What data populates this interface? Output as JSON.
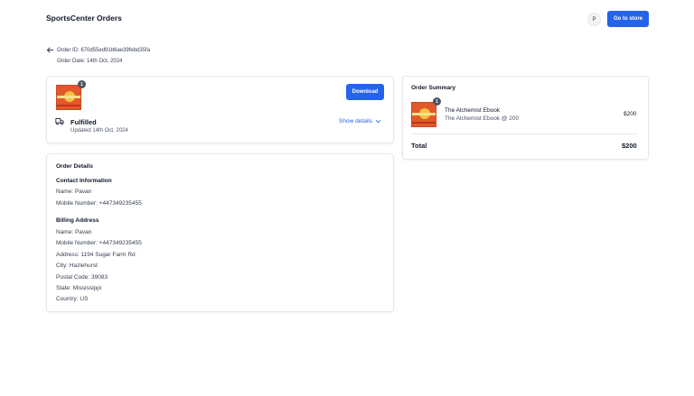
{
  "nav": {
    "brand": "SportsCenter",
    "orders_link": "Orders",
    "avatar_initial": "P",
    "store_button": "Go to store"
  },
  "order": {
    "id_text": "Order ID: 670d55ed91b6ae39febd35fa",
    "date_text": "Order Date: 14th Oct, 2024"
  },
  "status_card": {
    "item_count": "1",
    "download_label": "Download",
    "status": "Fulfilled",
    "updated": "Updated 14th Oct, 2024",
    "show_details": "Show details"
  },
  "details": {
    "title": "Order Details",
    "contact_title": "Contact Information",
    "contact_name": "Name: Pavan",
    "contact_mobile": "Mobile Number: +447349235455",
    "billing_title": "Billing Address",
    "billing_name": "Name: Pavan",
    "billing_mobile": "Mobile Number: +447349235455",
    "billing_address": "Address: 1194 Sugar Farm Rd",
    "billing_city": "City: Hazlehurst",
    "billing_postal": "Postal Code: 39083",
    "billing_state": "State: Mississippi",
    "billing_country": "Country: US"
  },
  "summary": {
    "title": "Order Summary",
    "item_count": "1",
    "item_name": "The Alchemist Ebook",
    "item_subtitle": "The Alchemist Ebook @ 200",
    "item_price": "$200",
    "total_label": "Total",
    "total_value": "$200"
  },
  "icons": {
    "back": "arrow-left-icon",
    "truck": "truck-icon",
    "chevron": "chevron-down-icon"
  },
  "colors": {
    "primary": "#2563eb",
    "book_cover": "#e2572b"
  }
}
